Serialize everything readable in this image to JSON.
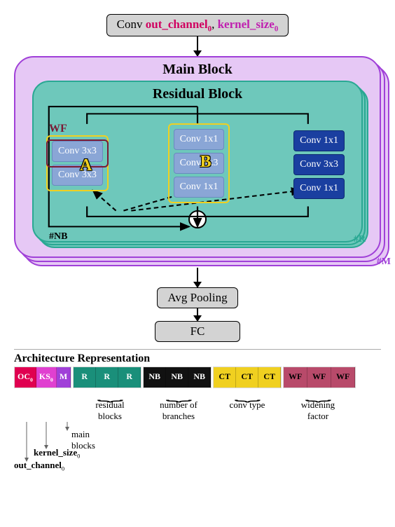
{
  "top_conv": {
    "prefix": "Conv ",
    "p1": "out_channel",
    "p1_sub": "0",
    "sep": ", ",
    "p2": "kernel_size",
    "p2_sub": "0"
  },
  "main_block_title": "Main Block",
  "residual_block_title": "Residual Block",
  "wf_label": "WF",
  "branch_a": {
    "letter": "A",
    "rows": [
      "Conv 3x3",
      "Conv 3x3"
    ]
  },
  "branch_b": {
    "letter": "B",
    "rows": [
      "Conv 1x1",
      "Conv 3x3",
      "Conv 1x1"
    ]
  },
  "branch_c": {
    "rows": [
      "Conv 1x1",
      "Conv 3x3",
      "Conv 1x1"
    ]
  },
  "plus": "+",
  "labels": {
    "nb": "#NB",
    "r": "#R",
    "m": "#M"
  },
  "avg_pool": "Avg Pooling",
  "fc": "FC",
  "legend_title": "Architecture Representation",
  "chips": {
    "oc": "OC",
    "oc_sub": "0",
    "ks": "KS",
    "ks_sub": "0",
    "m": "M",
    "r": "R",
    "nb": "NB",
    "ct": "CT",
    "wf": "WF"
  },
  "group_labels": {
    "residual": "residual\nblocks",
    "branches": "number of\nbranches",
    "convtype": "conv type",
    "wf": "widening\nfactor"
  },
  "leaders": {
    "main": "main\nblocks",
    "ks": "kernel_size",
    "ks_sub": "0",
    "oc": "out_channel",
    "oc_sub": "0"
  }
}
